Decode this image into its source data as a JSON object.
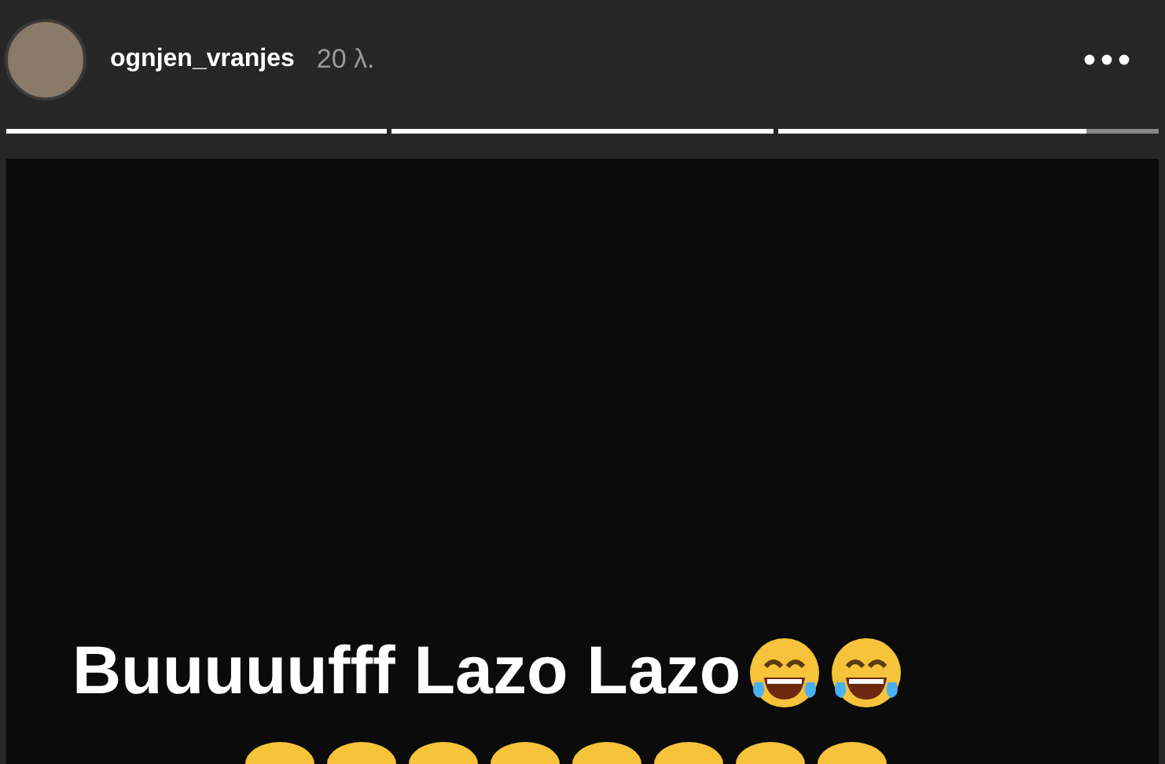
{
  "header": {
    "username": "ognjen_vranjes",
    "time": "20 λ."
  },
  "progress": [
    {
      "level": 1
    },
    {
      "level": 1
    },
    {
      "level": 0.81
    }
  ],
  "caption": "Buuuuufff Lazo Lazo"
}
